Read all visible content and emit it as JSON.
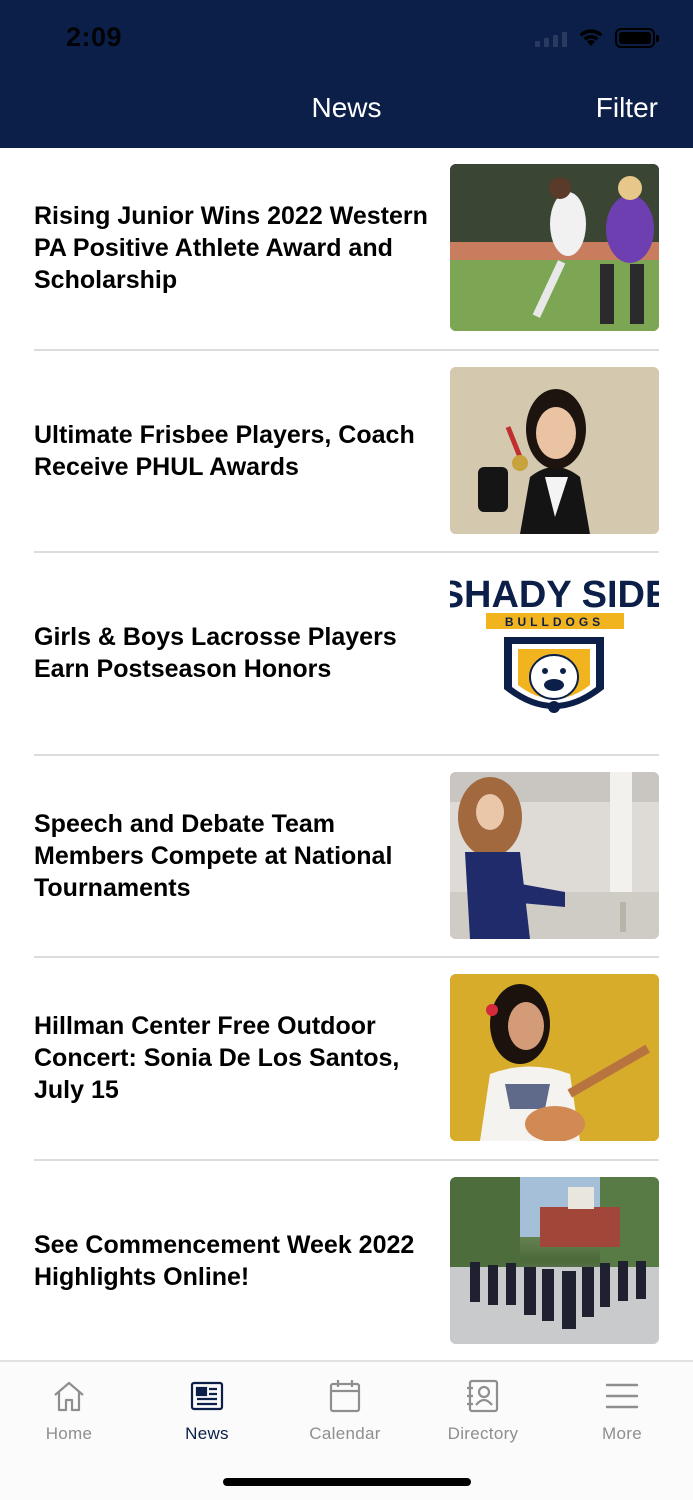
{
  "status": {
    "time": "2:09"
  },
  "nav": {
    "title": "News",
    "filter_label": "Filter"
  },
  "news": [
    {
      "title": "Rising Junior Wins 2022 Western PA Positive Athlete Award and Scholarship",
      "image": "field-hockey-photo"
    },
    {
      "title": "Ultimate Frisbee Players, Coach Receive PHUL Awards",
      "image": "student-medal-photo"
    },
    {
      "title": "Girls & Boys Lacrosse Players Earn Postseason Honors",
      "image": "shady-side-bulldogs-logo"
    },
    {
      "title": "Speech and Debate Team Members Compete at National Tournaments",
      "image": "debate-student-photo"
    },
    {
      "title": "Hillman Center Free Outdoor Concert: Sonia De Los Santos, July 15",
      "image": "singer-ukulele-photo"
    },
    {
      "title": "See Commencement Week 2022 Highlights Online!",
      "image": "commencement-procession-photo"
    }
  ],
  "logo": {
    "line1": "SHADY SIDE",
    "line2": "BULLDOGS"
  },
  "colors": {
    "navy": "#0b1f48",
    "gold": "#f2b41e",
    "tab_inactive": "#8e8e8e"
  },
  "tabs": [
    {
      "label": "Home",
      "icon": "home-icon"
    },
    {
      "label": "News",
      "icon": "newspaper-icon"
    },
    {
      "label": "Calendar",
      "icon": "calendar-icon"
    },
    {
      "label": "Directory",
      "icon": "directory-icon"
    },
    {
      "label": "More",
      "icon": "menu-icon"
    }
  ]
}
